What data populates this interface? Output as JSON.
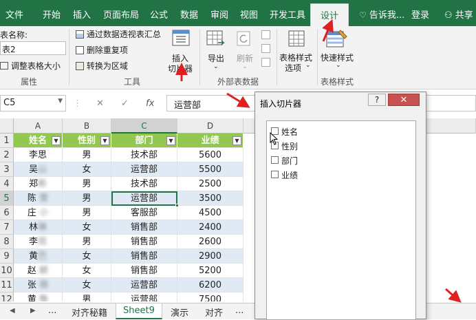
{
  "tabs": [
    {
      "label": "文件"
    },
    {
      "label": "开始"
    },
    {
      "label": "插入"
    },
    {
      "label": "页面布局"
    },
    {
      "label": "公式"
    },
    {
      "label": "数据"
    },
    {
      "label": "审阅"
    },
    {
      "label": "视图"
    },
    {
      "label": "开发工具"
    },
    {
      "label": "设计"
    }
  ],
  "tell_me": "告诉我...",
  "login": "登录",
  "share": "共享",
  "ribbon": {
    "table_name_label": "表名称:",
    "table_name_value": "表2",
    "resize_table": "调整表格大小",
    "properties_group": "属性",
    "summarize_pivot": "通过数据透视表汇总",
    "remove_duplicates": "删除重复项",
    "convert_range": "转换为区域",
    "insert_slicer_line1": "插入",
    "insert_slicer_line2": "切片器",
    "tools_group": "工具",
    "export": "导出",
    "refresh": "刷新",
    "external_group": "外部表数据",
    "style_options_line1": "表格样式",
    "style_options_line2": "选项",
    "quick_styles": "快速样式",
    "table_styles_group": "表格样式"
  },
  "formula_bar": {
    "name_box": "C5",
    "fx": "fx",
    "cancel": "✕",
    "enter": "✓",
    "content": "运营部"
  },
  "grid": {
    "columns": [
      "A",
      "B",
      "C",
      "D"
    ],
    "rows": [
      "1",
      "2",
      "3",
      "4",
      "5",
      "6",
      "7",
      "8",
      "9",
      "10",
      "11",
      "12"
    ],
    "header": [
      "姓名",
      "性别",
      "部门",
      "业绩"
    ],
    "filter_glyph": "▼",
    "data": [
      [
        "李思",
        "男",
        "技术部",
        "5600"
      ],
      [
        "吴山",
        "女",
        "运营部",
        "5500"
      ],
      [
        "郑新",
        "男",
        "技术部",
        "2500"
      ],
      [
        "陈  雯",
        "男",
        "运营部",
        "3500"
      ],
      [
        "庄  小",
        "男",
        "客服部",
        "4500"
      ],
      [
        "林琳",
        "女",
        "销售部",
        "2400"
      ],
      [
        "李现",
        "男",
        "销售部",
        "2600"
      ],
      [
        "黄巴",
        "女",
        "销售部",
        "2900"
      ],
      [
        "赵  颖",
        "女",
        "销售部",
        "5200"
      ],
      [
        "张  萌",
        "女",
        "运营部",
        "6200"
      ],
      [
        "黄  敬",
        "男",
        "运营部",
        "7500"
      ]
    ]
  },
  "sheet_tabs": {
    "ellipsis": "...",
    "tabs": [
      {
        "label": "对齐秘籍"
      },
      {
        "label": "Sheet9"
      },
      {
        "label": "演示"
      },
      {
        "label": "对齐"
      }
    ],
    "more": "..."
  },
  "dialog": {
    "title": "插入切片器",
    "help": "?",
    "close": "✕",
    "items": [
      {
        "label": "姓名"
      },
      {
        "label": "性别"
      },
      {
        "label": "部门"
      },
      {
        "label": "业绩"
      }
    ]
  },
  "colors": {
    "excel_green": "#217346",
    "table_header": "#92c84f",
    "band": "#dfeaf5",
    "annotation_arrow": "#e02020"
  }
}
